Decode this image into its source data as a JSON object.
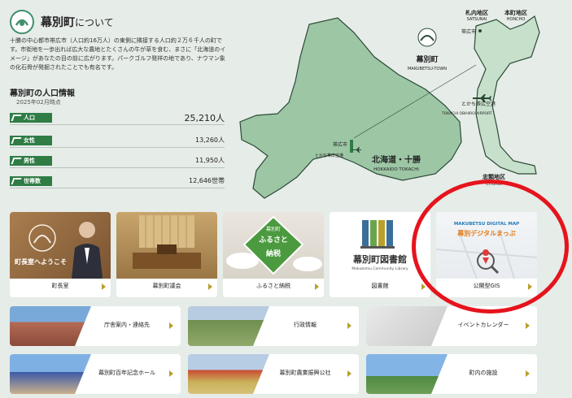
{
  "header": {
    "title": "幕別町",
    "title_suffix": "について"
  },
  "intro": "十勝の中心都市帯広市（人口約16万人）の東側に隣接する人口約２万６千人の町です。市街地を一歩出れば広大な農地とたくさんの牛が草を食む、まさに「北海道のイメージ」があなたの目の前に広がります。パークゴルフ発祥の地であり、ナウマン象の化石骨が発掘されたことでも有名です。",
  "population": {
    "title": "幕別町の人口情報",
    "date": "2025年02月時点",
    "rows": [
      {
        "label": "人口",
        "value": "25,210人"
      },
      {
        "label": "女性",
        "value": "13,260人"
      },
      {
        "label": "男性",
        "value": "11,950人"
      },
      {
        "label": "世帯数",
        "value": "12,646世帯"
      }
    ]
  },
  "map": {
    "makubetsu": "幕別町",
    "makubetsu_en": "MAKUBETSU-TOWN",
    "satsunai": "札内地区",
    "satsunai_en": "SATSUNAI",
    "honcho": "本町地区",
    "honcho_en": "HONCHO",
    "chuurui": "忠類地区",
    "chuurui_en": "CHURUI",
    "obihiro_city_1": "帯広市",
    "obihiro_city_2": "帯広市",
    "airport": "とかち帯広空港",
    "airport_en": "TOKACHI OBIHIRO AIRPORT",
    "airport_2": "とかち帯広空港",
    "region": "北海道・十勝",
    "region_en": "HOKKAIDO TOKACHI",
    "colors": {
      "land": "#9dc6a5",
      "town": "#c7e0cb",
      "stroke": "#2a4a36"
    }
  },
  "tiles": [
    {
      "label": "町長室",
      "overlay": "町長室へようこそ"
    },
    {
      "label": "幕別町議会"
    },
    {
      "label": "ふるさと納税",
      "overlay_1": "幕別町",
      "overlay_2": "ふるさと",
      "overlay_3": "納税"
    },
    {
      "label": "図書館",
      "overlay_1": "幕別町図書館",
      "overlay_2": "Makubetsu Community Library"
    },
    {
      "label": "公開型GIS",
      "overlay_1": "MAKUBETSU DIGITAL MAP",
      "overlay_2": "幕別デジタルまっぷ"
    }
  ],
  "buttons": [
    {
      "label": "庁舎案内・連絡先"
    },
    {
      "label": "行政情報"
    },
    {
      "label": "イベントカレンダー"
    },
    {
      "label": "幕別町百年記念ホール"
    },
    {
      "label": "幕別町農業振興公社"
    },
    {
      "label": "町内の施設"
    }
  ],
  "annotation": {
    "color": "#e5141d"
  }
}
